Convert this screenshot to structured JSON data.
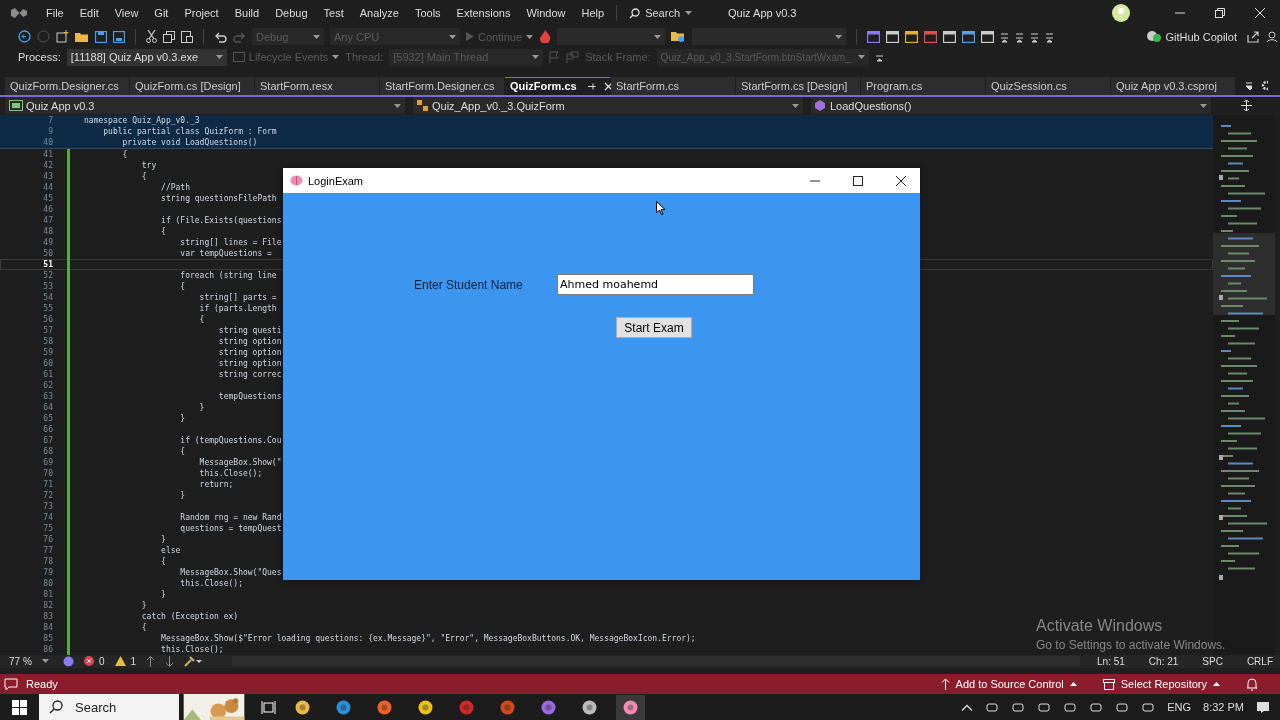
{
  "menu_bar": {
    "items": [
      "File",
      "Edit",
      "View",
      "Git",
      "Project",
      "Build",
      "Debug",
      "Test",
      "Analyze",
      "Tools",
      "Extensions",
      "Window",
      "Help"
    ],
    "search": "Search",
    "solution_title": "Quiz App v0.3"
  },
  "toolbar": {
    "configuration": "Debug",
    "platform": "Any CPU",
    "continue": "Continue",
    "copilot": "GitHub Copilot"
  },
  "debug_bar": {
    "process_label": "Process:",
    "process": "[11188] Quiz App v0.3.exe",
    "lifecycle": "Lifecycle Events",
    "thread_label": "Thread:",
    "thread": "[5932] Main Thread",
    "stack_frame_label": "Stack Frame:",
    "stack_frame": "Quiz_App_v0_3.StartForm.btnStartWxam_"
  },
  "tabs": [
    {
      "label": "QuizForm.Designer.cs",
      "selected": false
    },
    {
      "label": "QuizForm.cs [Design]",
      "selected": false
    },
    {
      "label": "StartForm.resx",
      "selected": false
    },
    {
      "label": "StartForm.Designer.cs",
      "selected": false
    },
    {
      "label": "QuizForm.cs",
      "selected": true
    },
    {
      "label": "StartForm.cs",
      "selected": false
    },
    {
      "label": "StartForm.cs [Design]",
      "selected": false
    },
    {
      "label": "Program.cs",
      "selected": false
    },
    {
      "label": "QuizSession.cs",
      "selected": false
    },
    {
      "label": "Quiz App v0.3.csproj",
      "selected": false
    }
  ],
  "navigation_bar": {
    "project": "Quiz App v0.3",
    "class": "Quiz_App_v0._3.QuizForm",
    "member": "LoadQuestions()"
  },
  "editor": {
    "sticky_lines": [
      {
        "number": "7",
        "text": "namespace Quiz_App_v0._3"
      },
      {
        "number": "9",
        "text": "    public partial class QuizForm : Form"
      },
      {
        "number": "40",
        "text": "        private void LoadQuestions()"
      }
    ],
    "lines": [
      {
        "number": "41",
        "text": "        {",
        "current": false
      },
      {
        "number": "42",
        "text": "            try",
        "current": false
      },
      {
        "number": "43",
        "text": "            {",
        "current": false
      },
      {
        "number": "44",
        "text": "                //Path",
        "current": false
      },
      {
        "number": "45",
        "text": "                string questionsFilePath",
        "current": false
      },
      {
        "number": "46",
        "current": false
      },
      {
        "number": "47",
        "text": "                if (File.Exists(questions",
        "current": false
      },
      {
        "number": "48",
        "text": "                {",
        "current": false
      },
      {
        "number": "49",
        "text": "                    string[] lines = File",
        "current": false
      },
      {
        "number": "50",
        "text": "                    var tempQuestions =",
        "current": false
      },
      {
        "number": "51",
        "current": true
      },
      {
        "number": "52",
        "text": "                    foreach (string line",
        "current": false
      },
      {
        "number": "53",
        "text": "                    {",
        "current": false
      },
      {
        "number": "54",
        "text": "                        string[] parts =",
        "current": false
      },
      {
        "number": "55",
        "text": "                        if (parts.Length",
        "current": false
      },
      {
        "number": "56",
        "text": "                        {",
        "current": false
      },
      {
        "number": "57",
        "text": "                            string questi",
        "current": false
      },
      {
        "number": "58",
        "text": "                            string option",
        "current": false
      },
      {
        "number": "59",
        "text": "                            string option",
        "current": false
      },
      {
        "number": "60",
        "text": "                            string option",
        "current": false
      },
      {
        "number": "61",
        "text": "                            string correc",
        "current": false
      },
      {
        "number": "62",
        "current": false
      },
      {
        "number": "63",
        "text": "                            tempQuestions",
        "current": false
      },
      {
        "number": "64",
        "text": "                        }",
        "current": false
      },
      {
        "number": "65",
        "text": "                    }",
        "current": false
      },
      {
        "number": "66",
        "current": false
      },
      {
        "number": "67",
        "text": "                    if (tempQuestions.Cou",
        "current": false
      },
      {
        "number": "68",
        "text": "                    {",
        "current": false
      },
      {
        "number": "69",
        "text": "                        MessageBox.Show(\"",
        "current": false
      },
      {
        "number": "70",
        "text": "                        this.Close();",
        "current": false
      },
      {
        "number": "71",
        "text": "                        return;",
        "current": false
      },
      {
        "number": "72",
        "text": "                    }",
        "current": false
      },
      {
        "number": "73",
        "current": false
      },
      {
        "number": "74",
        "text": "                    Random rng = new Rand",
        "current": false
      },
      {
        "number": "75",
        "text": "                    questions = tempQuest",
        "current": false
      },
      {
        "number": "76",
        "text": "                }",
        "current": false
      },
      {
        "number": "77",
        "text": "                else",
        "current": false
      },
      {
        "number": "78",
        "text": "                {",
        "current": false
      },
      {
        "number": "79",
        "text": "                    MessageBox.Show(\"Ques",
        "current": false
      },
      {
        "number": "80",
        "text": "                    this.Close();",
        "current": false
      },
      {
        "number": "81",
        "text": "                }",
        "current": false
      },
      {
        "number": "82",
        "text": "            }",
        "current": false
      },
      {
        "number": "83",
        "text": "            catch (Exception ex)",
        "current": false
      },
      {
        "number": "84",
        "text": "            {",
        "current": false
      },
      {
        "number": "85",
        "text": "                MessageBox.Show($\"Error loading questions: {ex.Message}\", \"Error\", MessageBoxButtons.OK, MessageBoxIcon.Error);",
        "current": false
      },
      {
        "number": "86",
        "text": "                this.Close();",
        "current": false
      }
    ]
  },
  "editor_status": {
    "zoom": "77 %",
    "errors": "0",
    "warnings": "1",
    "line": "Ln: 51",
    "column": "Ch: 21",
    "whitespace": "SPC",
    "line_ending": "CRLF"
  },
  "dialog": {
    "title": "LoginExam",
    "label": "Enter Student Name",
    "value": "Ahmed moahemd",
    "button": "Start Exam"
  },
  "status_bar": {
    "state": "Ready",
    "source_control": "Add to Source Control",
    "repository": "Select Repository"
  },
  "activation_notice": {
    "title": "Activate Windows",
    "message": "Go to Settings to activate Windows."
  },
  "taskbar": {
    "search_placeholder": "Search",
    "language": "ENG",
    "time": "8:32 PM"
  }
}
